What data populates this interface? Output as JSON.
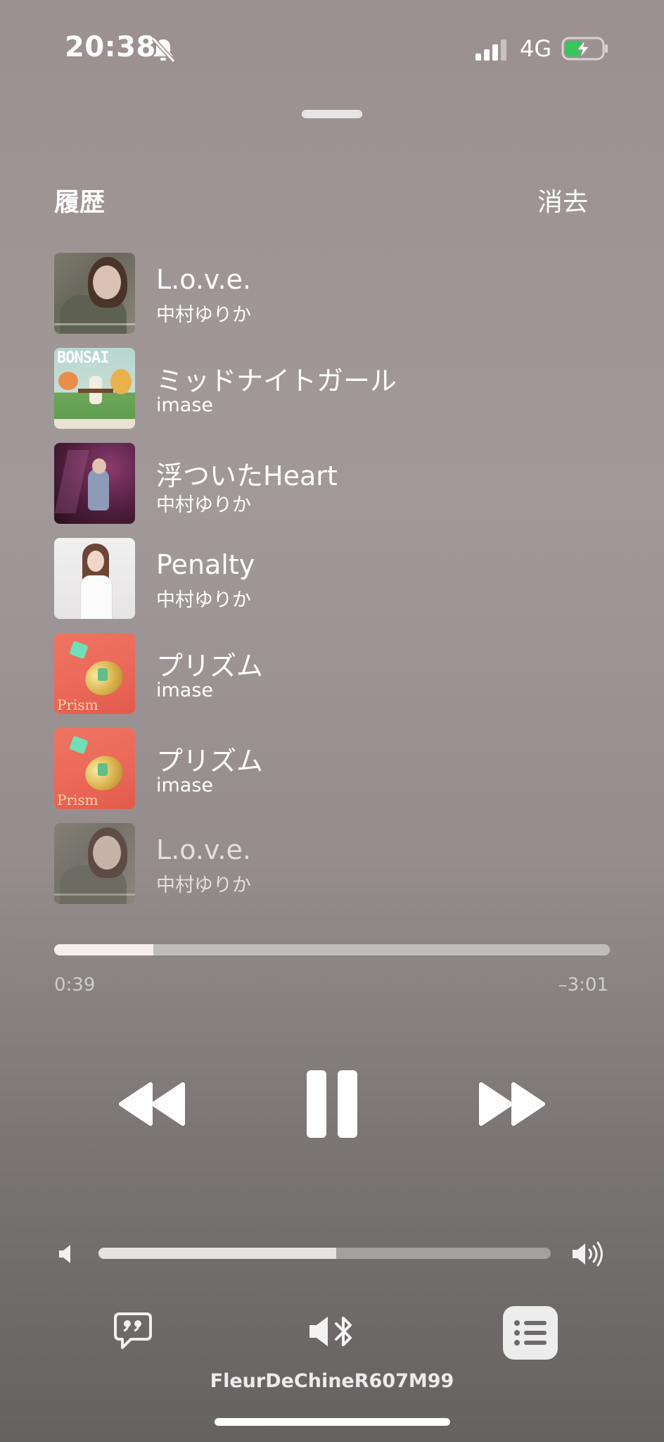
{
  "status_bar": {
    "time": "20:38",
    "network": "4G",
    "silent_mode": true,
    "signal_bars": 4,
    "battery_level": 0.45,
    "battery_charging": true,
    "battery_accent": "#34c759"
  },
  "history": {
    "title": "履歴",
    "clear_label": "消去",
    "tracks": [
      {
        "title": "L.o.v.e.",
        "artist": "中村ゆりか",
        "artwork": "love"
      },
      {
        "title": "ミッドナイトガール",
        "artist": "imase",
        "artwork": "bonsai",
        "artwork_text": "BONSAI"
      },
      {
        "title": "浮ついたHeart",
        "artist": "中村ゆりか",
        "artwork": "heart"
      },
      {
        "title": "Penalty",
        "artist": "中村ゆりか",
        "artwork": "penalty"
      },
      {
        "title": "プリズム",
        "artist": "imase",
        "artwork": "prism",
        "artwork_text": "Prism"
      },
      {
        "title": "プリズム",
        "artist": "imase",
        "artwork": "prism",
        "artwork_text": "Prism"
      },
      {
        "title": "L.o.v.e.",
        "artist": "中村ゆりか",
        "artwork": "love"
      }
    ]
  },
  "playback": {
    "elapsed": "0:39",
    "remaining": "–3:01",
    "progress": 0.178,
    "state": "playing",
    "icons": {
      "rewind": "rewind-icon",
      "pause": "pause-icon",
      "forward": "fast-forward-icon"
    }
  },
  "volume": {
    "level": 0.525,
    "icons": {
      "min": "speaker-low-icon",
      "max": "speaker-high-icon"
    }
  },
  "bottom_bar": {
    "device_name": "FleurDeChineR607M99",
    "icons": {
      "lyrics": "lyrics-icon",
      "output": "bluetooth-speaker-icon",
      "queue": "queue-list-icon"
    }
  }
}
